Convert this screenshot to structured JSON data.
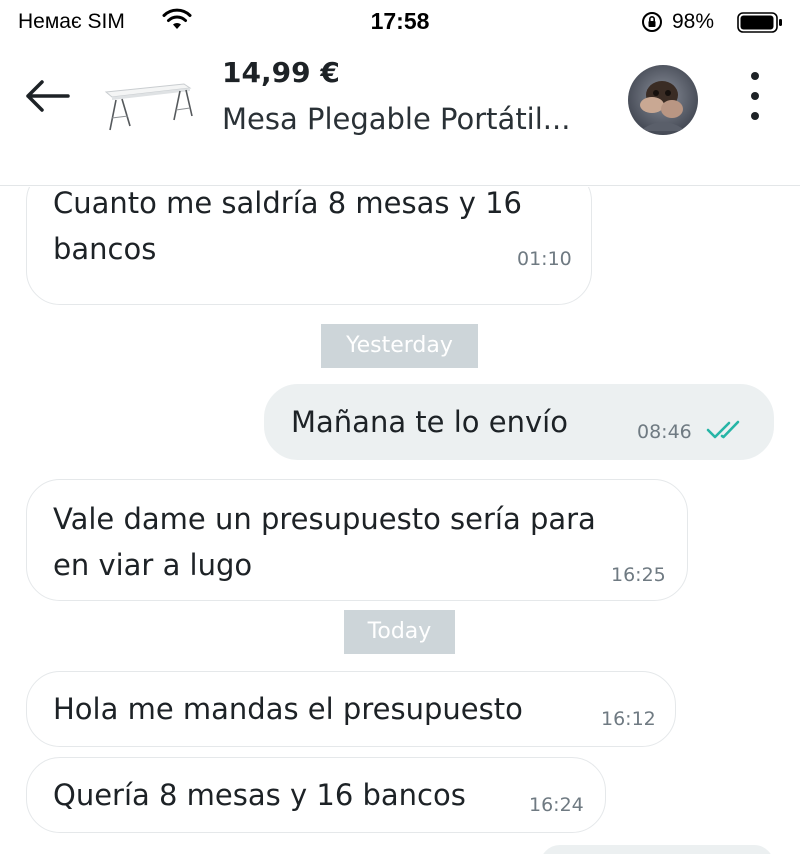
{
  "status_bar": {
    "carrier": "Немає SIM",
    "time": "17:58",
    "battery": "98%"
  },
  "header": {
    "price": "14,99 €",
    "title": "Mesa Plegable Portátil..."
  },
  "messages": [
    {
      "line1": "Cuanto me saldría 8 mesas y 16",
      "line2": "bancos",
      "time": "01:10"
    },
    {
      "text": "Mañana te lo envío",
      "time": "08:46",
      "read": true
    },
    {
      "line1": "Vale dame un presupuesto sería para",
      "line2": "en viar a lugo",
      "time": "16:25"
    },
    {
      "text": "Hola me mandas el presupuesto",
      "time": "16:12"
    },
    {
      "text": "Quería 8 mesas y 16 bancos",
      "time": "16:24"
    }
  ],
  "date_separators": [
    "Yesterday",
    "Today"
  ],
  "colors": {
    "tick": "#26b5a6",
    "separator": "#cdd5d9",
    "mine_bubble": "#ecf0f1"
  },
  "icons": [
    "wifi-icon",
    "rotation-lock-icon",
    "battery-icon",
    "back-arrow-icon",
    "more-vertical-icon"
  ]
}
